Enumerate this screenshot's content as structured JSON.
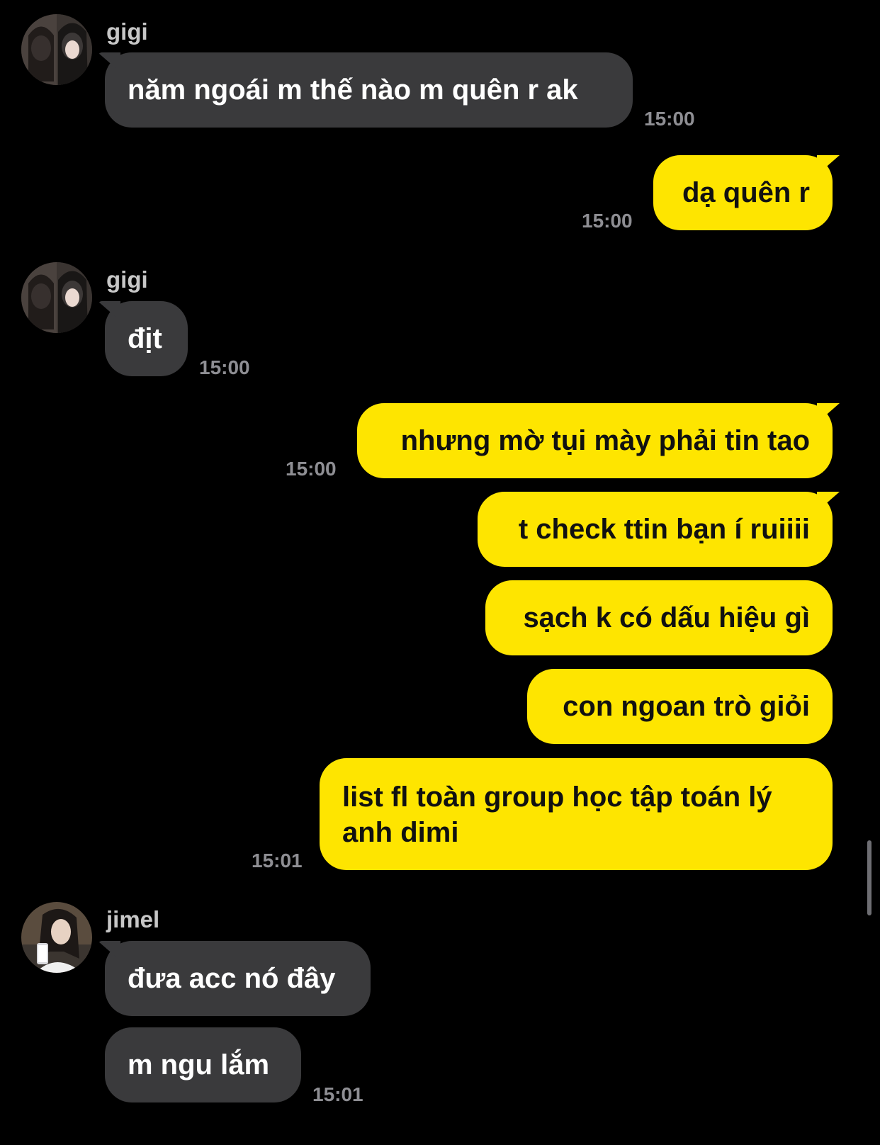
{
  "colors": {
    "background": "#000000",
    "incoming_bubble": "#3a3a3c",
    "outgoing_bubble": "#fee500",
    "timestamp": "#8e8e93",
    "sender_name": "#c7c7c7"
  },
  "messages": [
    {
      "sender": "gigi",
      "avatar_icon": "user-avatar-icon",
      "text": "năm ngoái m thế nào m quên r ak",
      "time": "15:00"
    },
    {
      "text": "dạ quên r",
      "time": "15:00"
    },
    {
      "sender": "gigi",
      "avatar_icon": "user-avatar-icon",
      "text": "địt",
      "time": "15:00"
    },
    {
      "text": "nhưng mờ tụi mày phải tin tao",
      "time": "15:00"
    },
    {
      "text": "t check ttin bạn í ruiiii"
    },
    {
      "text": "sạch k có dấu hiệu gì"
    },
    {
      "text": "con ngoan trò giỏi"
    },
    {
      "text": "list fl toàn group học tập toán lý anh dimi",
      "time": "15:01"
    },
    {
      "sender": "jimel",
      "avatar_icon": "user-avatar-icon",
      "text": "đưa acc nó đây"
    },
    {
      "text": "m ngu lắm",
      "time": "15:01"
    }
  ]
}
